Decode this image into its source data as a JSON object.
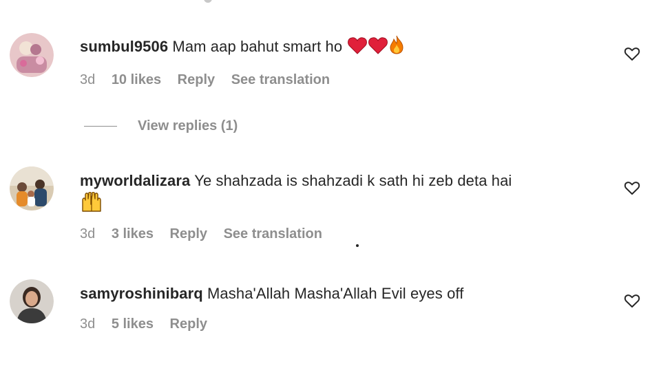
{
  "comments": [
    {
      "username": "sumbul9506",
      "text": "Mam aap bahut smart ho",
      "emojis": [
        "red-heart",
        "red-heart",
        "fire"
      ],
      "time": "3d",
      "likes": "10 likes",
      "reply": "Reply",
      "translation": "See translation",
      "avatar": "avatar-pink-photo"
    },
    {
      "username": "myworldalizara",
      "text": "Ye shahzada is shahzadi k sath hi zeb deta hai",
      "emojis": [
        "raising-hands"
      ],
      "time": "3d",
      "likes": "3 likes",
      "reply": "Reply",
      "translation": "See translation",
      "avatar": "avatar-family-photo"
    },
    {
      "username": "samyroshinibarq",
      "text": "Masha'Allah Masha'Allah Evil eyes off",
      "time": "3d",
      "likes": "5 likes",
      "reply": "Reply",
      "avatar": "avatar-woman-photo"
    }
  ],
  "view_replies": {
    "label": "View replies (1)"
  },
  "colors": {
    "text_primary": "#262626",
    "text_secondary": "#8e8e8e",
    "heart_red": "#e0203a",
    "fire_orange": "#f57c00",
    "background": "#ffffff"
  },
  "icons": {
    "like": "heart-outline-icon"
  }
}
